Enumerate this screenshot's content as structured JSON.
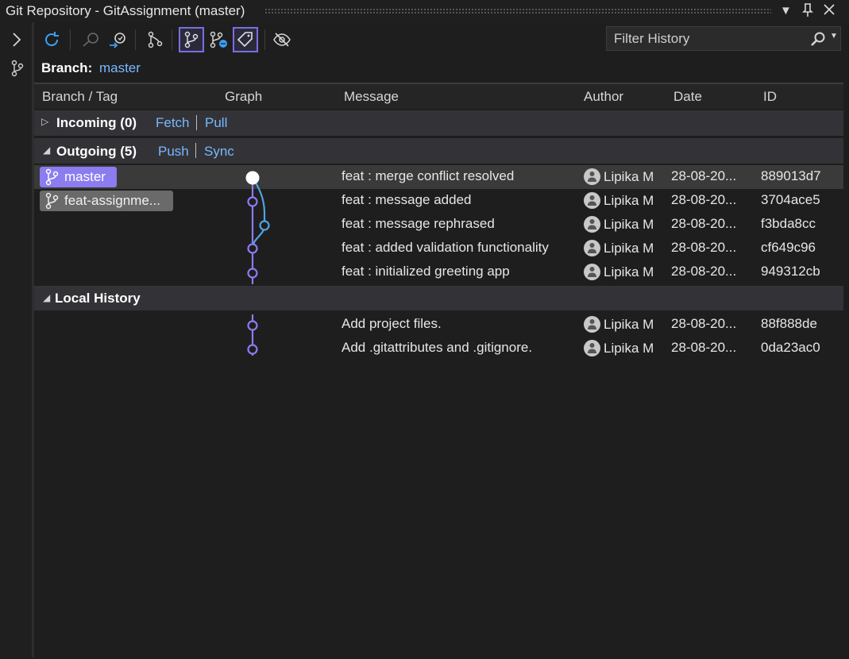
{
  "window": {
    "title": "Git Repository - GitAssignment (master)"
  },
  "toolbar": {
    "filter_placeholder": "Filter History"
  },
  "branch": {
    "label": "Branch:",
    "value": "master"
  },
  "columns": {
    "branch_tag": "Branch / Tag",
    "graph": "Graph",
    "message": "Message",
    "author": "Author",
    "date": "Date",
    "id": "ID"
  },
  "incoming": {
    "title": "Incoming (0)",
    "fetch": "Fetch",
    "pull": "Pull"
  },
  "outgoing": {
    "title": "Outgoing (5)",
    "push": "Push",
    "sync": "Sync"
  },
  "local": {
    "title": "Local History"
  },
  "tags": {
    "master": "master",
    "feat": "feat-assignme..."
  },
  "commits": [
    {
      "message": "feat : merge conflict resolved",
      "author": "Lipika M",
      "date": "28-08-20...",
      "id": "889013d7"
    },
    {
      "message": "feat : message added",
      "author": "Lipika M",
      "date": "28-08-20...",
      "id": "3704ace5"
    },
    {
      "message": "feat : message rephrased",
      "author": "Lipika M",
      "date": "28-08-20...",
      "id": "f3bda8cc"
    },
    {
      "message": "feat : added validation functionality",
      "author": "Lipika M",
      "date": "28-08-20...",
      "id": "cf649c96"
    },
    {
      "message": "feat : initialized greeting app",
      "author": "Lipika M",
      "date": "28-08-20...",
      "id": "949312cb"
    },
    {
      "message": "Add project files.",
      "author": "Lipika M",
      "date": "28-08-20...",
      "id": "88f888de"
    },
    {
      "message": "Add .gitattributes and .gitignore.",
      "author": "Lipika M",
      "date": "28-08-20...",
      "id": "0da23ac0"
    }
  ],
  "colors": {
    "accent": "#8b7cf0",
    "link": "#79b8ff",
    "graph_main": "#8b7cf0",
    "graph_branch": "#4fa3e0"
  }
}
